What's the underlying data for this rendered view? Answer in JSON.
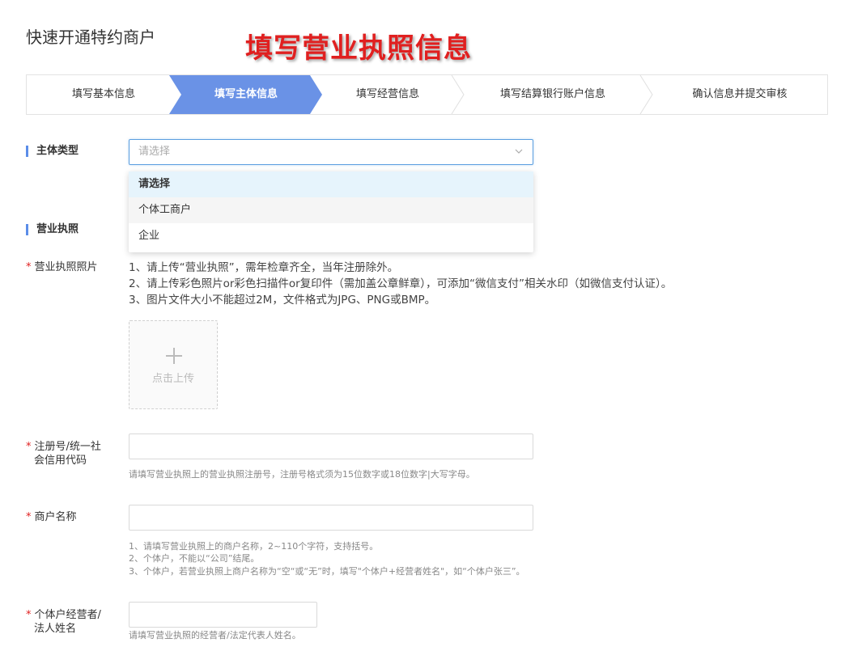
{
  "page": {
    "title": "快速开通特约商户",
    "annotation": "填写营业执照信息"
  },
  "steps": [
    {
      "label": "填写基本信息",
      "active": false
    },
    {
      "label": "填写主体信息",
      "active": true
    },
    {
      "label": "填写经营信息",
      "active": false
    },
    {
      "label": "填写结算银行账户信息",
      "active": false
    },
    {
      "label": "确认信息并提交审核",
      "active": false
    }
  ],
  "colors": {
    "accent": "#6a92e6",
    "required": "#e02020"
  },
  "subject_type": {
    "label": "主体类型",
    "placeholder": "请选择",
    "options": [
      "请选择",
      "个体工商户",
      "企业"
    ],
    "selected_option": "请选择",
    "hovered_option": "个体工商户",
    "expanded": true
  },
  "license_section": {
    "label": "营业执照"
  },
  "license_photo": {
    "required_mark": "*",
    "label": "营业执照照片",
    "hints": [
      "1、请上传“营业执照”，需年检章齐全，当年注册除外。",
      "2、请上传彩色照片or彩色扫描件or复印件（需加盖公章鲜章），可添加“微信支付”相关水印（如微信支付认证）。",
      "3、图片文件大小不能超过2M，文件格式为JPG、PNG或BMP。"
    ],
    "upload_label": "点击上传"
  },
  "reg_number": {
    "required_mark": "*",
    "label_line1": "注册号/统一社",
    "label_line2": "会信用代码",
    "value": "",
    "hint": "请填写营业执照上的营业执照注册号，注册号格式须为15位数字或18位数字|大写字母。"
  },
  "merchant_name": {
    "required_mark": "*",
    "label": "商户名称",
    "value": "",
    "hints": [
      "1、请填写营业执照上的商户名称，2~110个字符，支持括号。",
      "2、个体户，不能以“公司”结尾。",
      "3、个体户，若营业执照上商户名称为“空“或“无”时，填写\"个体户+经营者姓名\"，如“个体户张三”。"
    ]
  },
  "legal_person": {
    "required_mark": "*",
    "label_line1": "个体户经营者/",
    "label_line2": "法人姓名",
    "value": "",
    "hint": "请填写营业执照的经营者/法定代表人姓名。"
  }
}
